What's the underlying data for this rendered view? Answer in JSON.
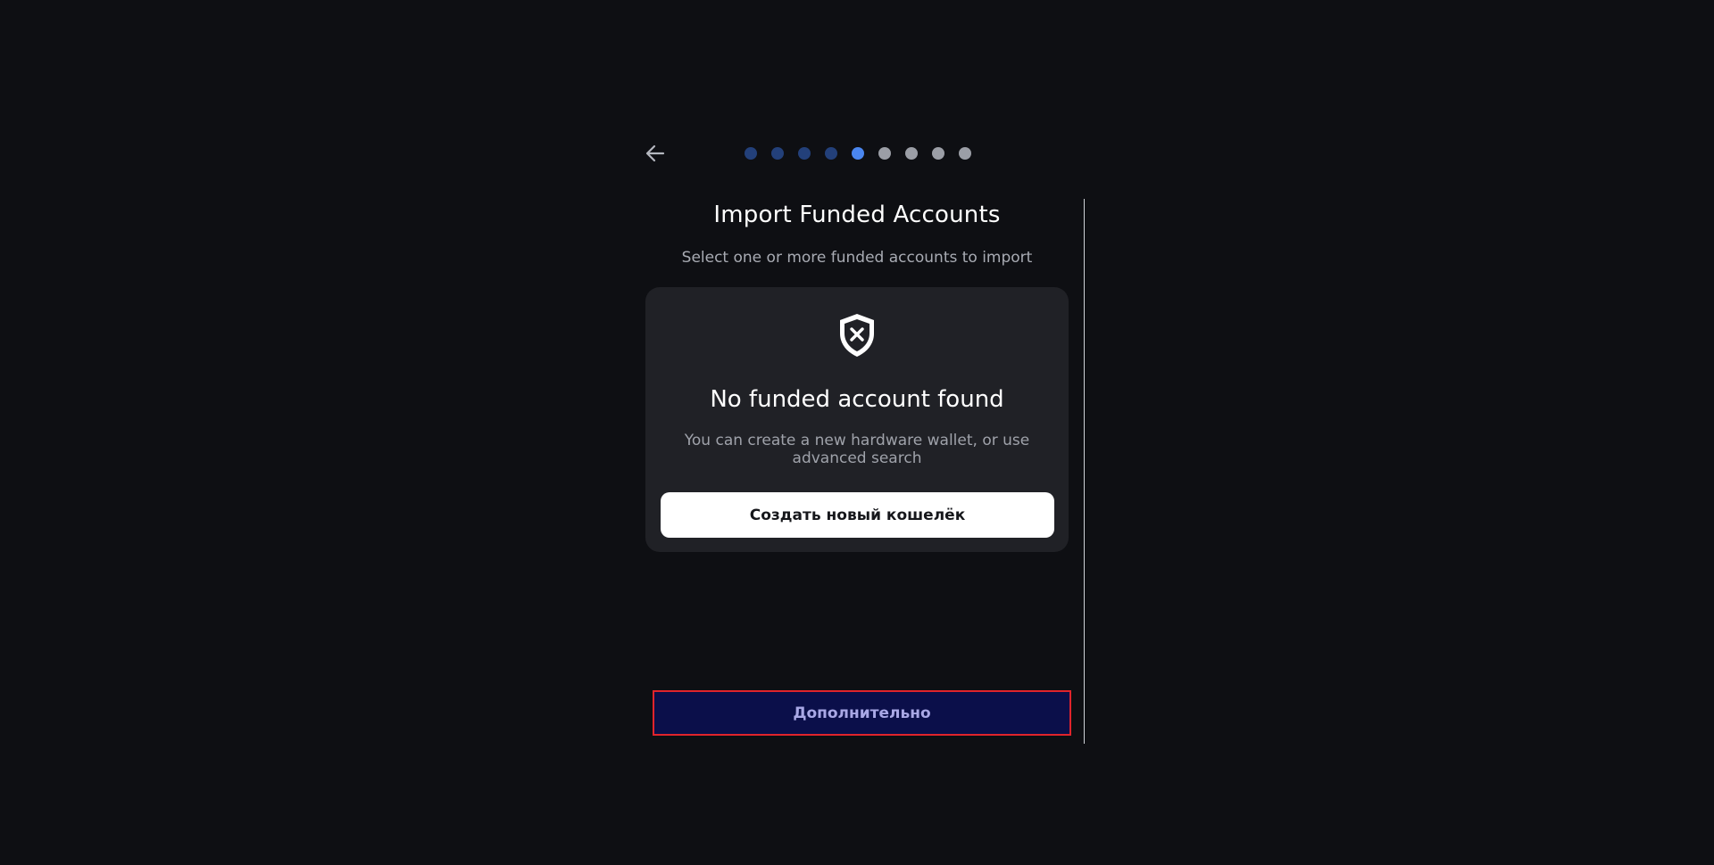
{
  "header": {
    "back_icon": "arrow-left-icon",
    "steps": {
      "total": 9,
      "completed": 4,
      "current": 5
    },
    "colors": {
      "completed": "#23407a",
      "active": "#4a86ef",
      "upcoming": "#9b9ea6"
    }
  },
  "main": {
    "title": "Import Funded Accounts",
    "subtitle": "Select one or more funded accounts to import"
  },
  "empty_state": {
    "icon": "shield-x-icon",
    "heading": "No funded account found",
    "description": "You can create a new hardware wallet, or use advanced search",
    "create_button_label": "Создать новый кошелёк"
  },
  "footer": {
    "advanced_button_label": "Дополнительно"
  }
}
